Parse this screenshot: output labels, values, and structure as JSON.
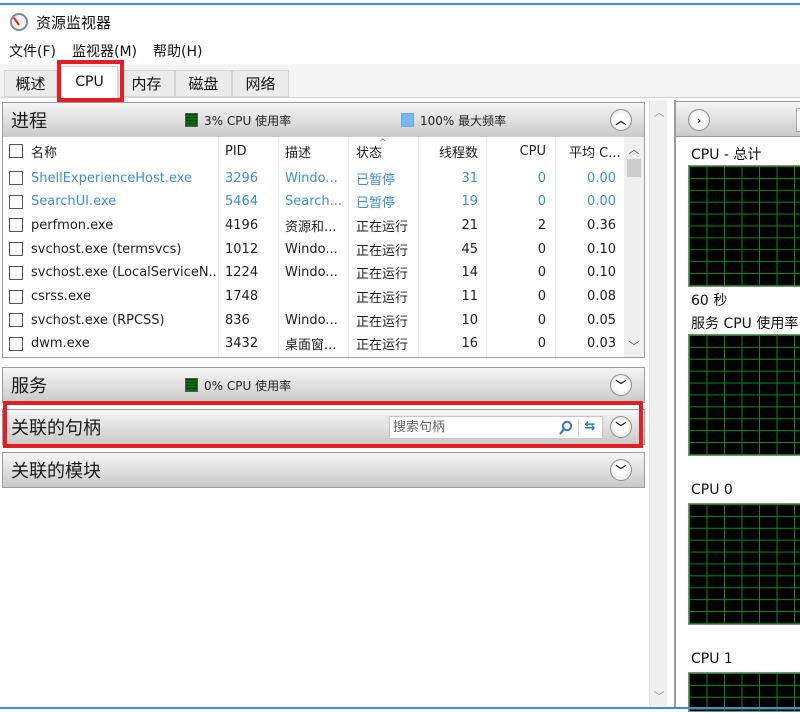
{
  "window": {
    "title": "资源监视器",
    "icon": "resource-monitor-gauge-icon"
  },
  "menu": [
    "文件(F)",
    "监视器(M)",
    "帮助(H)"
  ],
  "tabs": [
    {
      "label": "概述",
      "active": false
    },
    {
      "label": "CPU",
      "active": true
    },
    {
      "label": "内存",
      "active": false
    },
    {
      "label": "磁盘",
      "active": false
    },
    {
      "label": "网络",
      "active": false
    }
  ],
  "processes": {
    "title": "进程",
    "cpu_usage_legend": "3% CPU 使用率",
    "max_freq_legend": "100% 最大频率",
    "collapse_icon": "chevron-up-icon",
    "columns": [
      "名称",
      "PID",
      "描述",
      "状态",
      "线程数",
      "CPU",
      "平均 C..."
    ],
    "rows": [
      {
        "name": "ShellExperienceHost.exe",
        "pid": "3296",
        "desc": "Windo...",
        "state": "已暂停",
        "threads": "31",
        "cpu": "0",
        "avg": "0.00",
        "suspended": true
      },
      {
        "name": "SearchUI.exe",
        "pid": "5464",
        "desc": "Search...",
        "state": "已暂停",
        "threads": "19",
        "cpu": "0",
        "avg": "0.00",
        "suspended": true
      },
      {
        "name": "perfmon.exe",
        "pid": "4196",
        "desc": "资源和...",
        "state": "正在运行",
        "threads": "21",
        "cpu": "2",
        "avg": "0.36",
        "suspended": false
      },
      {
        "name": "svchost.exe (termsvcs)",
        "pid": "1012",
        "desc": "Windo...",
        "state": "正在运行",
        "threads": "45",
        "cpu": "0",
        "avg": "0.10",
        "suspended": false
      },
      {
        "name": "svchost.exe (LocalServiceN...",
        "pid": "1224",
        "desc": "Windo...",
        "state": "正在运行",
        "threads": "14",
        "cpu": "0",
        "avg": "0.10",
        "suspended": false
      },
      {
        "name": "csrss.exe",
        "pid": "1748",
        "desc": "",
        "state": "正在运行",
        "threads": "11",
        "cpu": "0",
        "avg": "0.08",
        "suspended": false
      },
      {
        "name": "svchost.exe (RPCSS)",
        "pid": "836",
        "desc": "Windo...",
        "state": "正在运行",
        "threads": "10",
        "cpu": "0",
        "avg": "0.05",
        "suspended": false
      },
      {
        "name": "dwm.exe",
        "pid": "3432",
        "desc": "桌面窗...",
        "state": "正在运行",
        "threads": "16",
        "cpu": "0",
        "avg": "0.03",
        "suspended": false
      }
    ]
  },
  "services": {
    "title": "服务",
    "cpu_usage_legend": "0% CPU 使用率"
  },
  "handles": {
    "title": "关联的句柄",
    "search_placeholder": "搜索句柄"
  },
  "modules": {
    "title": "关联的模块"
  },
  "graphs": {
    "labels": [
      "CPU - 总计",
      "60 秒",
      "服务 CPU 使用率",
      "CPU 0",
      "CPU 1"
    ]
  },
  "colors": {
    "accent": "#3c8fd7",
    "highlight_box": "#e31e24",
    "suspended_text": "#3b8edc",
    "graph_grid": "#0e8a0e",
    "graph_bg": "#000000"
  }
}
